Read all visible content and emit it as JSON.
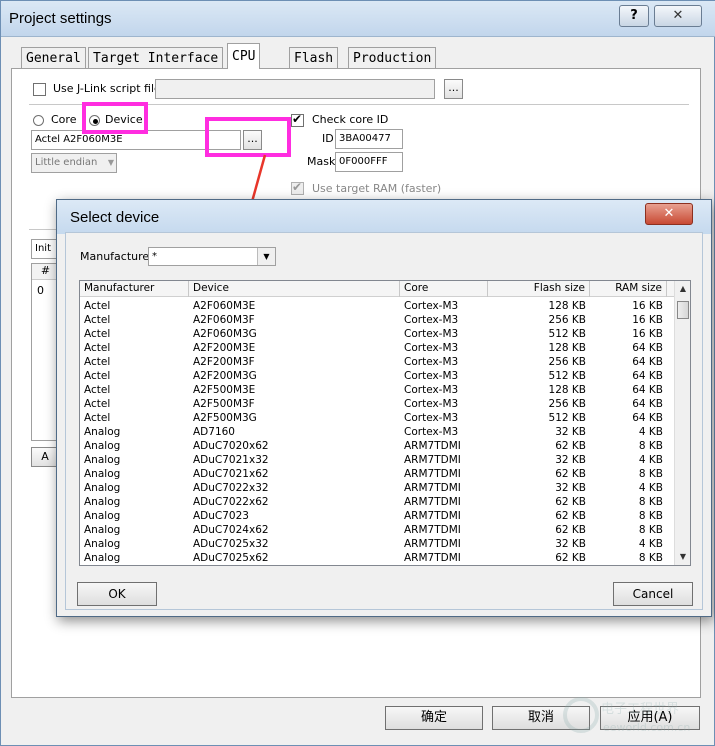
{
  "outer": {
    "title": "Project settings",
    "help_label": "?",
    "close_label": "✕",
    "tabs": [
      "General",
      "Target Interface",
      "CPU",
      "Flash",
      "Production"
    ],
    "jlink_script_label": "Use J-Link script file",
    "browse_label": "...",
    "radio_core": "Core",
    "radio_device": "Device",
    "device_value": "Actel A2F060M3E",
    "endian_value": "Little endian",
    "check_core_id_label": "Check core ID",
    "id_label": "ID",
    "id_value": "3BA00477",
    "mask_label": "Mask",
    "mask_value": "0F000FFF",
    "use_target_ram_label": "Use target RAM (faster)",
    "init_label": "Init s",
    "hash_label": "#",
    "row0": "0",
    "a_label": "A",
    "ok_label": "确定",
    "cancel_label": "取消",
    "apply_label": "应用(A)",
    "watermark_text": "电子工程世界 eeworld.com.cn"
  },
  "dialog": {
    "title": "Select device",
    "close_label": "✕",
    "manufacturer_label": "Manufacturer",
    "manufacturer_value": "*",
    "columns": [
      "Manufacturer",
      "Device",
      "Core",
      "Flash size",
      "RAM size"
    ],
    "rows": [
      [
        "Actel",
        "A2F060M3E",
        "Cortex-M3",
        "128 KB",
        "16 KB"
      ],
      [
        "Actel",
        "A2F060M3F",
        "Cortex-M3",
        "256 KB",
        "16 KB"
      ],
      [
        "Actel",
        "A2F060M3G",
        "Cortex-M3",
        "512 KB",
        "16 KB"
      ],
      [
        "Actel",
        "A2F200M3E",
        "Cortex-M3",
        "128 KB",
        "64 KB"
      ],
      [
        "Actel",
        "A2F200M3F",
        "Cortex-M3",
        "256 KB",
        "64 KB"
      ],
      [
        "Actel",
        "A2F200M3G",
        "Cortex-M3",
        "512 KB",
        "64 KB"
      ],
      [
        "Actel",
        "A2F500M3E",
        "Cortex-M3",
        "128 KB",
        "64 KB"
      ],
      [
        "Actel",
        "A2F500M3F",
        "Cortex-M3",
        "256 KB",
        "64 KB"
      ],
      [
        "Actel",
        "A2F500M3G",
        "Cortex-M3",
        "512 KB",
        "64 KB"
      ],
      [
        "Analog",
        "AD7160",
        "Cortex-M3",
        "32 KB",
        "4 KB"
      ],
      [
        "Analog",
        "ADuC7020x62",
        "ARM7TDMI",
        "62 KB",
        "8 KB"
      ],
      [
        "Analog",
        "ADuC7021x32",
        "ARM7TDMI",
        "32 KB",
        "4 KB"
      ],
      [
        "Analog",
        "ADuC7021x62",
        "ARM7TDMI",
        "62 KB",
        "8 KB"
      ],
      [
        "Analog",
        "ADuC7022x32",
        "ARM7TDMI",
        "32 KB",
        "4 KB"
      ],
      [
        "Analog",
        "ADuC7022x62",
        "ARM7TDMI",
        "62 KB",
        "8 KB"
      ],
      [
        "Analog",
        "ADuC7023",
        "ARM7TDMI",
        "62 KB",
        "8 KB"
      ],
      [
        "Analog",
        "ADuC7024x62",
        "ARM7TDMI",
        "62 KB",
        "8 KB"
      ],
      [
        "Analog",
        "ADuC7025x32",
        "ARM7TDMI",
        "32 KB",
        "4 KB"
      ],
      [
        "Analog",
        "ADuC7025x62",
        "ARM7TDMI",
        "62 KB",
        "8 KB"
      ]
    ],
    "ok_label": "OK",
    "cancel_label": "Cancel"
  },
  "colors": {
    "highlight": "#ff2de0",
    "arrow": "#e8362a"
  }
}
